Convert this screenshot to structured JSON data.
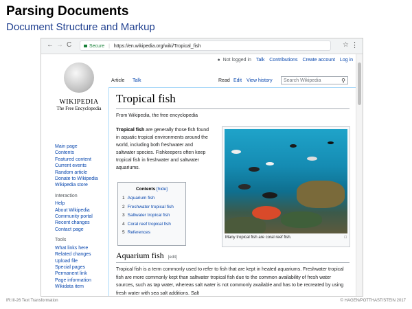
{
  "slide": {
    "title": "Parsing Documents",
    "subtitle": "Document Structure and Markup",
    "footer_left": "IR:III-26   Text Transformation",
    "footer_right": "© HAGEN/POTTHAST/STEIN 2017"
  },
  "browser": {
    "back": "←",
    "forward": "→",
    "reload": "C",
    "secure_label": "Secure",
    "url": "https://en.wikipedia.org/wiki/Tropical_fish",
    "star": "☆",
    "menu": "⋮"
  },
  "personal": {
    "not_logged_in": "Not logged in",
    "talk": "Talk",
    "contributions": "Contributions",
    "create_account": "Create account",
    "login": "Log in"
  },
  "logo": {
    "wordmark": "WIKIPEDIA",
    "tagline": "The Free Encyclopedia"
  },
  "sidebar": {
    "main": [
      "Main page",
      "Contents",
      "Featured content",
      "Current events",
      "Random article",
      "Donate to Wikipedia",
      "Wikipedia store"
    ],
    "interaction_head": "Interaction",
    "interaction": [
      "Help",
      "About Wikipedia",
      "Community portal",
      "Recent changes",
      "Contact page"
    ],
    "tools_head": "Tools",
    "tools": [
      "What links here",
      "Related changes",
      "Upload file",
      "Special pages",
      "Permanent link",
      "Page information",
      "Wikidata item"
    ]
  },
  "tabs": {
    "article": "Article",
    "talk": "Talk",
    "read": "Read",
    "edit": "Edit",
    "history": "View history",
    "search_placeholder": "Search Wikipedia"
  },
  "article": {
    "title": "Tropical fish",
    "from": "From Wikipedia, the free encyclopedia",
    "lead_bold": "Tropical fish",
    "lead_rest": " are generally those fish found in aquatic tropical environments around the world, including both freshwater and saltwater species. Fishkeepers often keep tropical fish in freshwater and saltwater aquariums.",
    "toc_title": "Contents",
    "toc_hide": "[hide]",
    "toc": [
      {
        "num": "1",
        "label": "Aquarium fish"
      },
      {
        "num": "2",
        "label": "Freshwater tropical fish"
      },
      {
        "num": "3",
        "label": "Saltwater tropical fish"
      },
      {
        "num": "4",
        "label": "Coral reef tropical fish"
      },
      {
        "num": "5",
        "label": "References"
      }
    ],
    "caption": "Many tropical fish are coral reef fish.",
    "section_title": "Aquarium fish",
    "section_edit": "[edit]",
    "section_body": "Tropical fish is a term commonly used to refer to fish that are kept in heated aquariums. Freshwater tropical fish are more commonly kept than saltwater tropical fish due to the common availability of fresh water sources, such as tap water, whereas salt water is not commonly available and has to be recreated by using fresh water with sea salt additions. Salt"
  }
}
